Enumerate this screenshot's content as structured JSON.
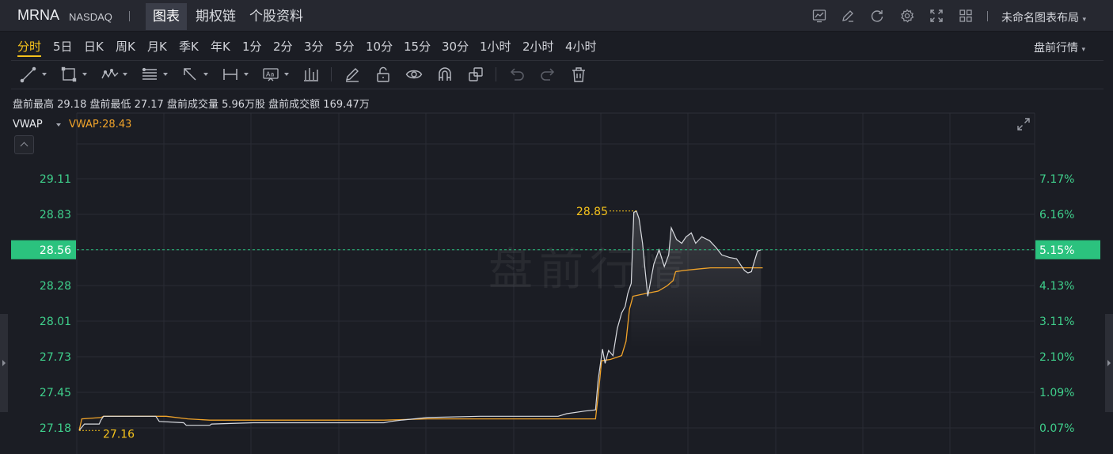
{
  "header": {
    "ticker": "MRNA",
    "exchange": "NASDAQ",
    "tabs": [
      "图表",
      "期权链",
      "个股资料"
    ],
    "active_tab": 0,
    "toolbar_icons": [
      "chart-settings-icon",
      "edit-icon",
      "refresh-icon",
      "gear-icon",
      "fullscreen-icon",
      "grid-layout-icon"
    ],
    "layout_name": "未命名图表布局"
  },
  "periods": {
    "items": [
      "分时",
      "5日",
      "日K",
      "周K",
      "月K",
      "季K",
      "年K",
      "1分",
      "2分",
      "3分",
      "5分",
      "10分",
      "15分",
      "30分",
      "1小时",
      "2小时",
      "4小时"
    ],
    "active": 0,
    "session": "盘前行情"
  },
  "drawing_tools": [
    "trend-line-icon",
    "rectangle-icon",
    "wave-icon",
    "fib-icon",
    "arrow-icon",
    "measure-icon",
    "text-icon",
    "volume-profile-icon",
    "pencil-icon",
    "unlock-icon",
    "eye-icon",
    "magnet-icon",
    "layers-icon",
    "undo-icon",
    "redo-icon",
    "trash-icon"
  ],
  "stats": {
    "text": "盘前最高 29.18 盘前最低 27.17 盘前成交量 5.96万股 盘前成交额 169.47万"
  },
  "indicator": {
    "name": "VWAP",
    "value": "VWAP:28.43"
  },
  "watermark": "盘前行情",
  "colors": {
    "background": "#1b1d24",
    "price_line": "#d9dbe0",
    "vwap_line": "#f0a32a",
    "axis_text": "#3fd08c",
    "current_price_badge": "#2bc27e",
    "annotation": "#f5c21c"
  },
  "chart_data": {
    "type": "line",
    "y_left_ticks": [
      "29.11",
      "28.83",
      "28.56",
      "28.28",
      "28.01",
      "27.73",
      "27.45",
      "27.18"
    ],
    "y_right_ticks": [
      "7.17%",
      "6.16%",
      "5.15%",
      "4.13%",
      "3.11%",
      "2.10%",
      "1.09%",
      "0.07%"
    ],
    "ylim": [
      27.18,
      29.11
    ],
    "current_price": "28.56",
    "current_pct": "5.15%",
    "high_label": "28.85",
    "low_label": "27.16",
    "series": [
      {
        "name": "price",
        "points": [
          [
            0,
            27.16
          ],
          [
            0.6,
            27.21
          ],
          [
            2.3,
            27.21
          ],
          [
            2.5,
            27.24
          ],
          [
            2.8,
            27.27
          ],
          [
            8.8,
            27.27
          ],
          [
            9.2,
            27.23
          ],
          [
            12.0,
            27.22
          ],
          [
            12.3,
            27.2
          ],
          [
            15.0,
            27.2
          ],
          [
            15.2,
            27.21
          ],
          [
            20.0,
            27.22
          ],
          [
            35.0,
            27.22
          ],
          [
            35.8,
            27.23
          ],
          [
            37.0,
            27.24
          ],
          [
            40.0,
            27.26
          ],
          [
            46.0,
            27.27
          ],
          [
            55.0,
            27.27
          ],
          [
            56.0,
            27.29
          ],
          [
            58.0,
            27.31
          ],
          [
            59.3,
            27.32
          ],
          [
            59.6,
            27.55
          ],
          [
            60.1,
            27.79
          ],
          [
            60.4,
            27.68
          ],
          [
            60.8,
            27.78
          ],
          [
            61.3,
            27.74
          ],
          [
            61.8,
            27.95
          ],
          [
            62.3,
            28.07
          ],
          [
            62.7,
            28.12
          ],
          [
            63.0,
            28.22
          ],
          [
            63.4,
            28.3
          ],
          [
            63.7,
            28.85
          ],
          [
            64.0,
            28.86
          ],
          [
            64.3,
            28.8
          ],
          [
            64.7,
            28.61
          ],
          [
            65.0,
            28.4
          ],
          [
            65.3,
            28.2
          ],
          [
            66.0,
            28.45
          ],
          [
            66.6,
            28.56
          ],
          [
            67.2,
            28.43
          ],
          [
            67.7,
            28.52
          ],
          [
            68.0,
            28.73
          ],
          [
            68.6,
            28.64
          ],
          [
            69.2,
            28.61
          ],
          [
            69.7,
            28.66
          ],
          [
            70.3,
            28.69
          ],
          [
            70.8,
            28.61
          ],
          [
            71.5,
            28.66
          ],
          [
            72.4,
            28.63
          ],
          [
            73.1,
            28.58
          ],
          [
            73.8,
            28.52
          ],
          [
            74.7,
            28.5
          ],
          [
            75.5,
            28.49
          ],
          [
            76.0,
            28.44
          ],
          [
            76.4,
            28.4
          ],
          [
            76.8,
            28.38
          ],
          [
            77.2,
            28.39
          ],
          [
            77.5,
            28.46
          ],
          [
            77.9,
            28.55
          ],
          [
            78.3,
            28.56
          ]
        ]
      },
      {
        "name": "VWAP",
        "points": [
          [
            0,
            27.16
          ],
          [
            0.3,
            27.25
          ],
          [
            2.5,
            27.26
          ],
          [
            2.8,
            27.27
          ],
          [
            10.0,
            27.27
          ],
          [
            12.5,
            27.25
          ],
          [
            15.0,
            27.24
          ],
          [
            30.0,
            27.24
          ],
          [
            35.0,
            27.24
          ],
          [
            40.0,
            27.25
          ],
          [
            55.0,
            27.25
          ],
          [
            59.3,
            27.25
          ],
          [
            59.6,
            27.43
          ],
          [
            60.0,
            27.7
          ],
          [
            61.0,
            27.71
          ],
          [
            62.3,
            27.74
          ],
          [
            62.8,
            27.85
          ],
          [
            63.2,
            28.1
          ],
          [
            63.6,
            28.2
          ],
          [
            65.0,
            28.22
          ],
          [
            66.5,
            28.24
          ],
          [
            67.5,
            28.28
          ],
          [
            68.2,
            28.32
          ],
          [
            68.5,
            28.39
          ],
          [
            69.5,
            28.4
          ],
          [
            71.0,
            28.41
          ],
          [
            72.5,
            28.42
          ],
          [
            78.5,
            28.42
          ]
        ]
      }
    ],
    "grid": true
  }
}
